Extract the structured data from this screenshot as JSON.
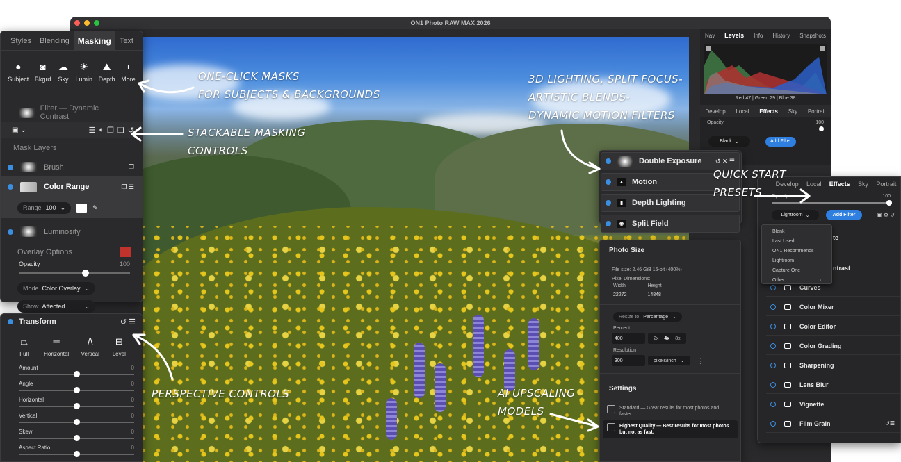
{
  "window": {
    "title": "ON1 Photo RAW MAX 2026"
  },
  "annotations": {
    "masks_1": "One-click masks",
    "masks_2": "for subjects & backgrounds",
    "stack_1": "Stackable masking",
    "stack_2": "controls",
    "lighting_1": "3D lighting, split focus-",
    "lighting_2": "artistic blends-",
    "lighting_3": "dynamic motion filters",
    "presets_1": "Quick start",
    "presets_2": "presets",
    "perspective": "Perspective controls",
    "ai_1": "AI upscaling",
    "ai_2": "models"
  },
  "masking": {
    "tabs": [
      "Styles",
      "Blending",
      "Masking",
      "Text"
    ],
    "active_tab": "Masking",
    "tools": [
      {
        "label": "Subject",
        "icon": "person-icon"
      },
      {
        "label": "Bkgrd",
        "icon": "background-icon"
      },
      {
        "label": "Sky",
        "icon": "cloud-icon"
      },
      {
        "label": "Lumin",
        "icon": "luminosity-icon"
      },
      {
        "label": "Depth",
        "icon": "depth-icon"
      },
      {
        "label": "More",
        "icon": "plus-icon"
      }
    ],
    "filter_label": "Filter — Dynamic Contrast",
    "mask_layers_label": "Mask Layers",
    "layers": [
      {
        "name": "Brush"
      },
      {
        "name": "Color Range"
      },
      {
        "name": "Luminosity"
      }
    ],
    "range_label": "Range",
    "range_value": "100",
    "overlay_options": "Overlay Options",
    "opacity_label": "Opacity",
    "opacity_value": "100",
    "opacity_level": 0.6,
    "mode_label": "Mode",
    "mode_value": "Color Overlay",
    "show_label": "Show",
    "show_value": "Affected"
  },
  "transform": {
    "title": "Transform",
    "tools": [
      "Full",
      "Horizontal",
      "Vertical",
      "Level"
    ],
    "params": [
      {
        "label": "Amount",
        "value": "0"
      },
      {
        "label": "Angle",
        "value": "0"
      },
      {
        "label": "Horizontal",
        "value": "0"
      },
      {
        "label": "Vertical",
        "value": "0"
      },
      {
        "label": "Skew",
        "value": "0"
      },
      {
        "label": "Aspect Ratio",
        "value": "0"
      }
    ]
  },
  "right_pane": {
    "tabs": [
      "Nav",
      "Levels",
      "Info",
      "History",
      "Snapshots"
    ],
    "active_tab": "Levels",
    "rgb_readout": "Red 47 | Green 29 | Blue 38",
    "module_tabs": [
      "Develop",
      "Local",
      "Effects",
      "Sky",
      "Portrait"
    ],
    "active_module": "Effects",
    "opacity_label": "Opacity",
    "opacity_value": "100",
    "blank_label": "Blank",
    "add_filter": "Add Filter"
  },
  "effects_stack": [
    {
      "name": "Double Exposure"
    },
    {
      "name": "Motion"
    },
    {
      "name": "Depth Lighting"
    },
    {
      "name": "Split Field"
    }
  ],
  "photo_size": {
    "title": "Photo Size",
    "file_size": "File size: 2.46 GiB 16-bit (400%)",
    "pixel_dims": "Pixel Dimensions:",
    "width_label": "Width",
    "height_label": "Height",
    "width": "22272",
    "height": "14848",
    "resize_label": "Resize to",
    "resize_value": "Percentage",
    "percent_label": "Percent",
    "percent_value": "400",
    "scale_opts": [
      "2x",
      "4x",
      "8x"
    ],
    "resolution_label": "Resolution",
    "resolution_value": "300",
    "resolution_unit": "pixels/inch",
    "settings_title": "Settings",
    "standard_opt": "Standard — Great results for most photos and faster.",
    "highest_opt": "Highest Quality — Best results for most photos but not as fast."
  },
  "effects_panel": {
    "tabs": [
      "Develop",
      "Local",
      "Effects",
      "Sky",
      "Portrait"
    ],
    "active_tab": "Effects",
    "opacity_label": "Opacity",
    "opacity_value": "100",
    "preset_value": "Lightroom",
    "add_filter": "Add Filter",
    "dropdown": [
      "Blank",
      "Last Used",
      "ON1 Recommends",
      "Lightroom",
      "Capture One",
      "Other"
    ],
    "partial_1": "te",
    "partial_2": "ntrast",
    "filters": [
      "Curves",
      "Color Mixer",
      "Color Editor",
      "Color Grading",
      "Sharpening",
      "Lens Blur",
      "Vignette",
      "Film Grain"
    ]
  }
}
